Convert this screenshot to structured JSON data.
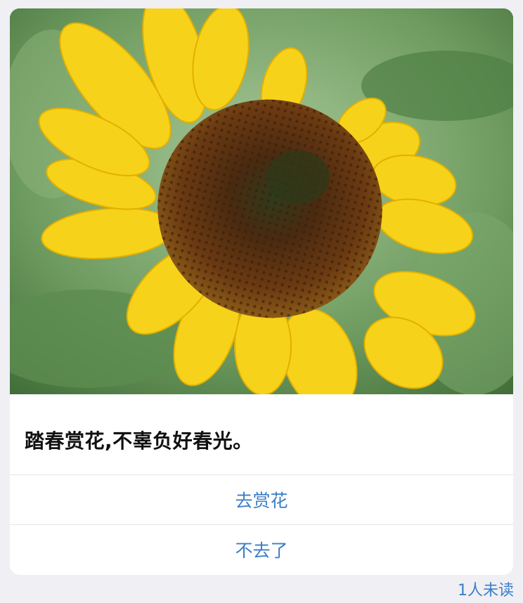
{
  "message": {
    "image": {
      "subject": "sunflower",
      "colors": {
        "petal": "#f7d21a",
        "petal_shade": "#e2b000",
        "center": "#5a2c0e",
        "center_inner": "#2f3a1c",
        "leaves": "#6d9c5c",
        "background": "#8fb88a"
      }
    },
    "text": "踏春赏花,不辜负好春光。",
    "actions": [
      {
        "label": "去赏花"
      },
      {
        "label": "不去了"
      }
    ],
    "read_status": "1人未读",
    "accent_color": "#3b7ec7"
  }
}
